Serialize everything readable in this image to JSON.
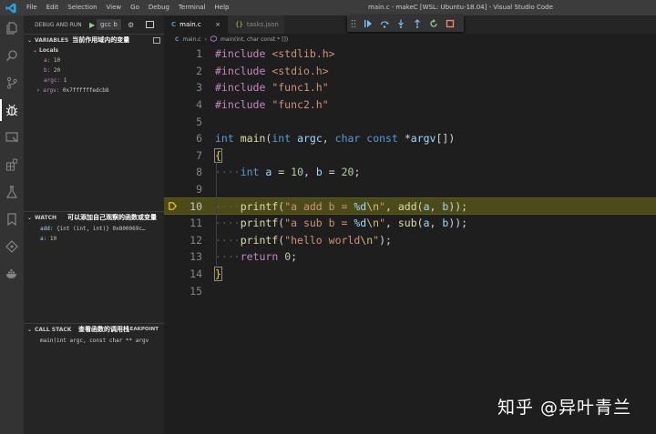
{
  "menu": [
    "File",
    "Edit",
    "Selection",
    "View",
    "Go",
    "Debug",
    "Terminal",
    "Help"
  ],
  "window_title": "main.c - makeC [WSL: Ubuntu-18.04] - Visual Studio Code",
  "sidebar": {
    "header": "DEBUG AND RUN",
    "config": "gcc b",
    "variables_title": "VARIABLES",
    "variables_annotation": "当前作用域内的变量",
    "locals_label": "Locals",
    "locals": [
      {
        "name": "a:",
        "value": "10"
      },
      {
        "name": "b:",
        "value": "20"
      },
      {
        "name": "argc:",
        "value": "1"
      },
      {
        "name": "argv:",
        "value": "0x7ffffffedcb8"
      }
    ],
    "watch_title": "WATCH",
    "watch_annotation": "可以添加自己观察的函数或变量",
    "watch": [
      {
        "name": "add:",
        "value": "{int (int, int)} 0x800069c…"
      },
      {
        "name": "a:",
        "value": "10"
      }
    ],
    "callstack_title": "CALL STACK",
    "callstack_annotation": "查看函数的调用栈",
    "callstack_right": "EAKPOINT",
    "callstack_frame": "main(int argc, const char ** argv"
  },
  "tabs": [
    {
      "icon": "C",
      "label": "main.c",
      "close": "×"
    },
    {
      "icon": "{}",
      "label": "tasks.json"
    }
  ],
  "breadcrumb": {
    "file": "main.c",
    "sep": "›",
    "symbol": "main(int, char const * [])"
  },
  "editor": {
    "line_numbers": [
      "1",
      "2",
      "3",
      "4",
      "5",
      "6",
      "7",
      "8",
      "9",
      "10",
      "11",
      "12",
      "13",
      "14",
      "15"
    ],
    "lines": [
      "#include <stdlib.h>",
      "#include <stdio.h>",
      "#include \"func1.h\"",
      "#include \"func2.h\"",
      "",
      "int main(int argc, char const *argv[])",
      "{",
      "····int a = 10, b = 20;",
      "",
      "····printf(\"a add b = %d\\n\", add(a, b));",
      "····printf(\"a sub b = %d\\n\", sub(a, b));",
      "····printf(\"hello world\\n\");",
      "····return 0;",
      "}",
      ""
    ],
    "current_line": 10
  },
  "watermark": "知乎 @异叶青兰",
  "colors": {
    "titlebar": "#3c3c3c",
    "activity_bar": "#333333",
    "sidebar": "#252526",
    "editor": "#1e1e1e",
    "current_line_highlight": "#4b4b18",
    "breakpoint_arrow": "#ffcc00"
  },
  "icons": [
    "vscode-logo-icon",
    "explorer-icon",
    "search-icon",
    "source-control-icon",
    "debug-icon",
    "remote-explorer-icon",
    "extensions-icon",
    "test-icon",
    "bookmarks-icon",
    "git-graph-icon",
    "docker-icon",
    "play-icon",
    "gear-icon",
    "terminal-icon",
    "continue-icon",
    "step-over-icon",
    "step-into-icon",
    "step-out-icon",
    "restart-icon",
    "stop-icon"
  ]
}
